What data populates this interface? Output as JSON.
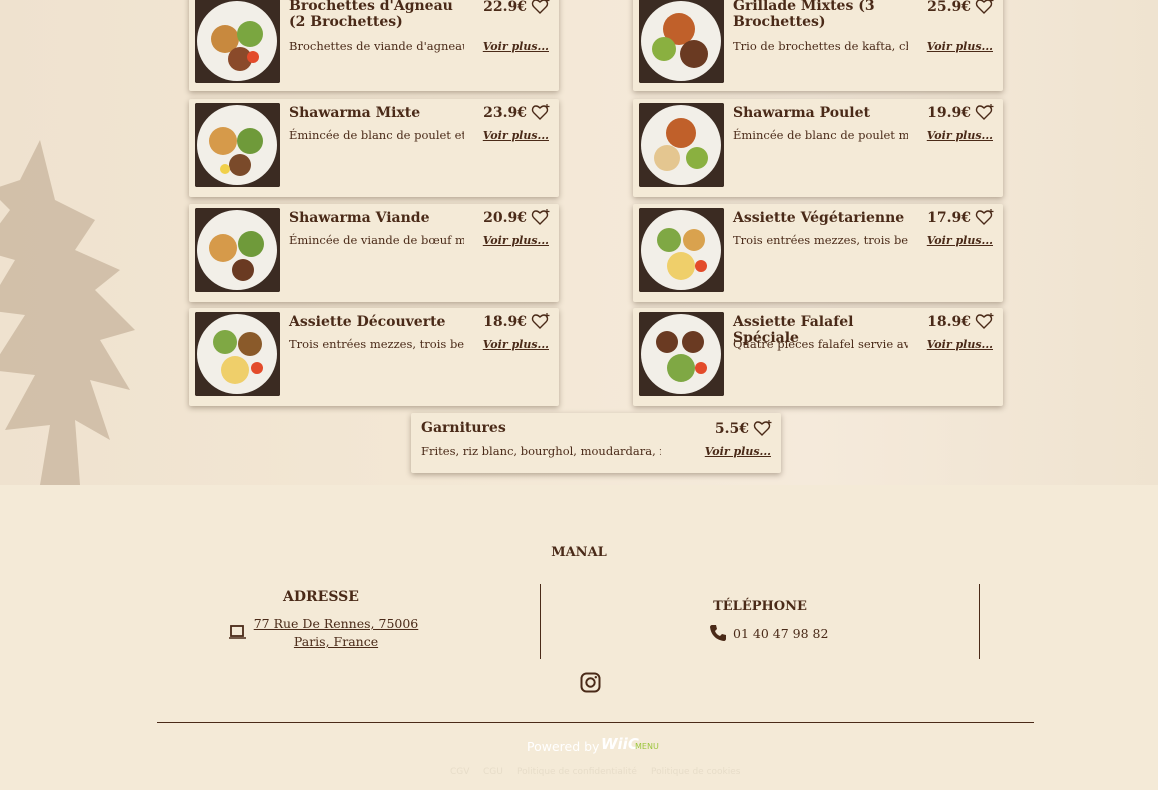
{
  "menu": {
    "fav_icon": "heart-plus-icon",
    "more_label": "Voir plus...",
    "items": [
      {
        "title": "Brochettes d'Agneau (2 Brochettes)",
        "price": "22.9€",
        "desc": "Brochettes de viande d'agneau..."
      },
      {
        "title": "Grillade Mixtes (3 Brochettes)",
        "price": "25.9€",
        "desc": "Trio de brochettes de kafta, chi..."
      },
      {
        "title": "Shawarma Mixte",
        "price": "23.9€",
        "desc": "Émincée de blanc de poulet et ..."
      },
      {
        "title": "Shawarma Poulet",
        "price": "19.9€",
        "desc": "Émincée de blanc de poulet m..."
      },
      {
        "title": "Shawarma Viande",
        "price": "20.9€",
        "desc": "Émincée de viande de bœuf m..."
      },
      {
        "title": "Assiette Végétarienne",
        "price": "17.9€",
        "desc": "Trois entrées mezzes, trois bei..."
      },
      {
        "title": "Assiette Découverte",
        "price": "18.9€",
        "desc": "Trois entrées mezzes, trois bei..."
      },
      {
        "title": "Assiette Falafel Spéciale",
        "price": "18.9€",
        "desc": "Quatre pièces falafel servie ave..."
      },
      {
        "title": "Garnitures",
        "price": "5.5€",
        "desc": "Frites, riz blanc, bourghol, moudardara, ri..."
      }
    ]
  },
  "footer": {
    "brand": "MANAL",
    "address": {
      "title": "ADRESSE",
      "line1": "77 Rue De Rennes, 75006",
      "line2": "Paris, France",
      "icon": "map-square-icon"
    },
    "phone": {
      "title": "TÉLÉPHONE",
      "number": "01 40 47 98 82",
      "icon": "phone-icon"
    },
    "social_icon": "instagram-icon",
    "powered_by": "Powered by",
    "powered_brand": "WiiC",
    "powered_brand_sub": "MENU",
    "legal_links": [
      "CGV",
      "CGU",
      "Politique de confidentialité",
      "Politique de cookies"
    ]
  },
  "colors": {
    "background": "#f4ead7",
    "text": "#4a2a18",
    "accent_green": "#9bc53d"
  }
}
